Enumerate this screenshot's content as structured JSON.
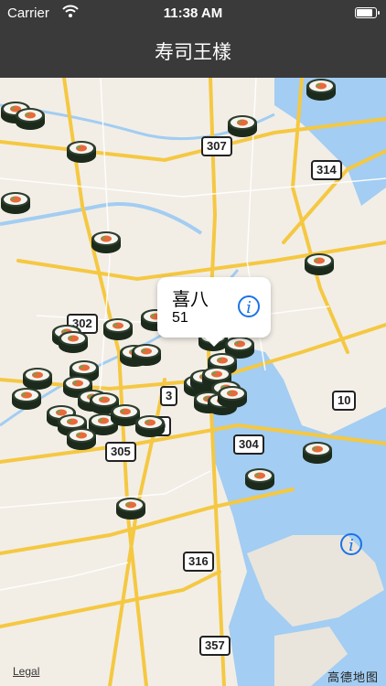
{
  "status_bar": {
    "carrier": "Carrier",
    "time": "11:38 AM",
    "battery_level": 0.9
  },
  "nav": {
    "title": "寿司王樣"
  },
  "callout": {
    "title": "喜八",
    "subtitle": "51"
  },
  "route_shields": [
    "307",
    "314",
    "302",
    "3",
    "0",
    "10",
    "304",
    "305",
    "316",
    "357"
  ],
  "map_footer": {
    "legal": "Legal",
    "brand": "高德地图"
  },
  "colors": {
    "bar": "#3a3a3a",
    "road_major": "#f5c842",
    "water": "#a3cdf2",
    "accent": "#1a73e8"
  }
}
